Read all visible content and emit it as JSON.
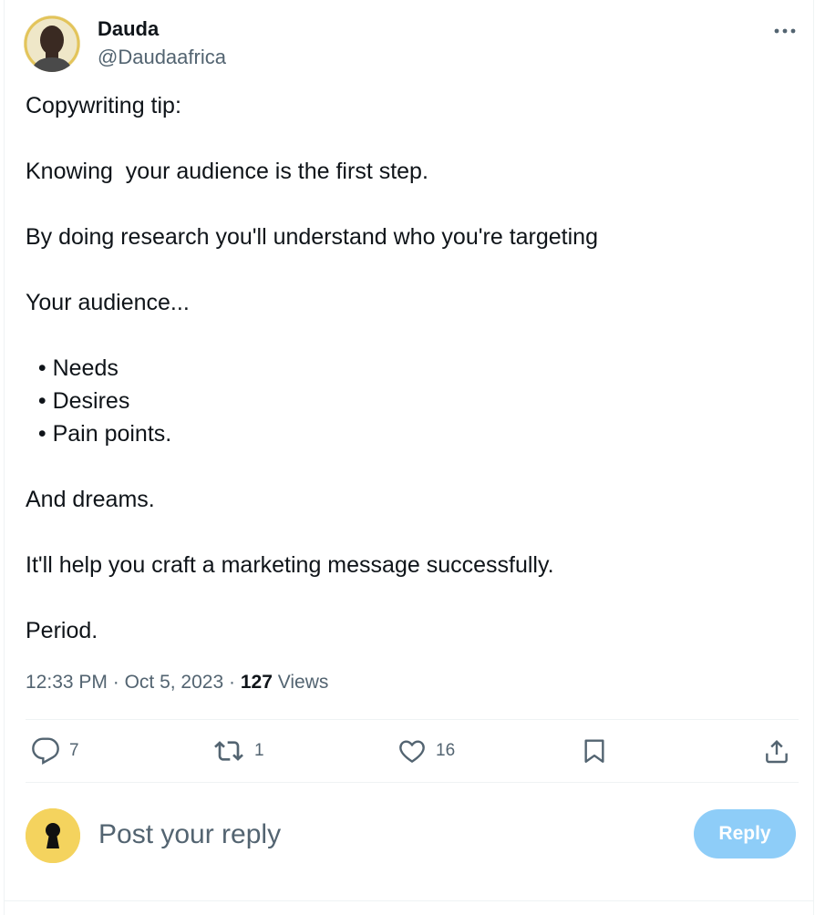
{
  "author": {
    "name": "Dauda",
    "handle": "@Daudaafrica"
  },
  "tweet": {
    "lines": [
      "Copywriting tip:",
      "",
      "Knowing  your audience is the first step.",
      "",
      "By doing research you'll understand who you're targeting",
      "",
      "Your audience...",
      "",
      "  • Needs",
      "  • Desires",
      "  • Pain points.",
      "",
      "And dreams.",
      "",
      "It'll help you craft a marketing message successfully.",
      "",
      "Period."
    ],
    "time": "12:33 PM",
    "date": "Oct 5, 2023",
    "separator": "·",
    "views_count": "127",
    "views_label": "Views"
  },
  "actions": {
    "replies": "7",
    "reposts": "1",
    "likes": "16"
  },
  "reply_box": {
    "placeholder": "Post your reply",
    "button_label": "Reply"
  },
  "icons": [
    "more-icon",
    "reply-icon",
    "repost-icon",
    "like-icon",
    "bookmark-icon",
    "share-icon",
    "avatar-image",
    "reply-avatar-image"
  ],
  "colors": {
    "text": "#0f1419",
    "secondary": "#536471",
    "reply_button": "#8ecdf8",
    "divider": "#eff3f4"
  }
}
